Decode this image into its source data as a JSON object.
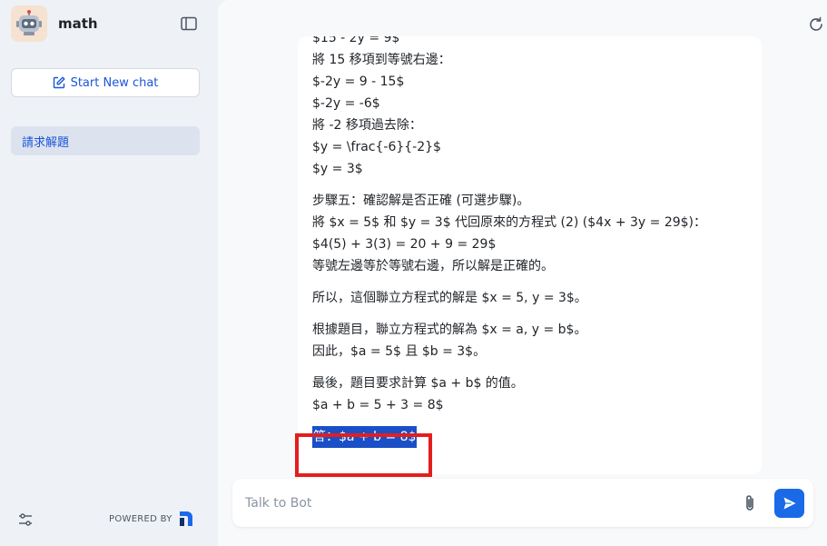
{
  "sidebar": {
    "bot_name": "math",
    "new_chat_label": "Start New chat",
    "chat_items": [
      {
        "label": "請求解題"
      }
    ],
    "powered_by": "POWERED BY"
  },
  "message": {
    "paragraphs": [
      [
        "$15 - 2y = 9$",
        "將 15 移項到等號右邊：",
        "$-2y = 9 - 15$",
        "$-2y = -6$",
        "將 -2 移項過去除：",
        "$y = \\frac{-6}{-2}$",
        "$y = 3$"
      ],
      [
        "步驟五：確認解是否正確 (可選步驟)。",
        "將 $x = 5$ 和 $y = 3$ 代回原來的方程式 (2) ($4x + 3y = 29$)：",
        "$4(5) + 3(3) = 20 + 9 = 29$",
        "等號左邊等於等號右邊，所以解是正確的。"
      ],
      [
        "所以，這個聯立方程式的解是 $x = 5, y = 3$。"
      ],
      [
        "根據題目，聯立方程式的解為 $x = a, y = b$。",
        "因此，$a = 5$ 且 $b = 3$。"
      ],
      [
        "最後，題目要求計算 $a + b$ 的值。",
        "$a + b = 5 + 3 = 8$"
      ]
    ],
    "answer": "答：$a + b = 8$"
  },
  "composer": {
    "placeholder": "Talk to Bot"
  },
  "colors": {
    "accent": "#1a6ae8",
    "highlight_border": "#e41d1d",
    "selection": "#1a4fc7"
  },
  "icons": [
    "robot-avatar-icon",
    "sidebar-toggle-icon",
    "edit-icon",
    "settings-sliders-icon",
    "brand-logo-icon",
    "refresh-icon",
    "paperclip-icon",
    "send-icon"
  ]
}
